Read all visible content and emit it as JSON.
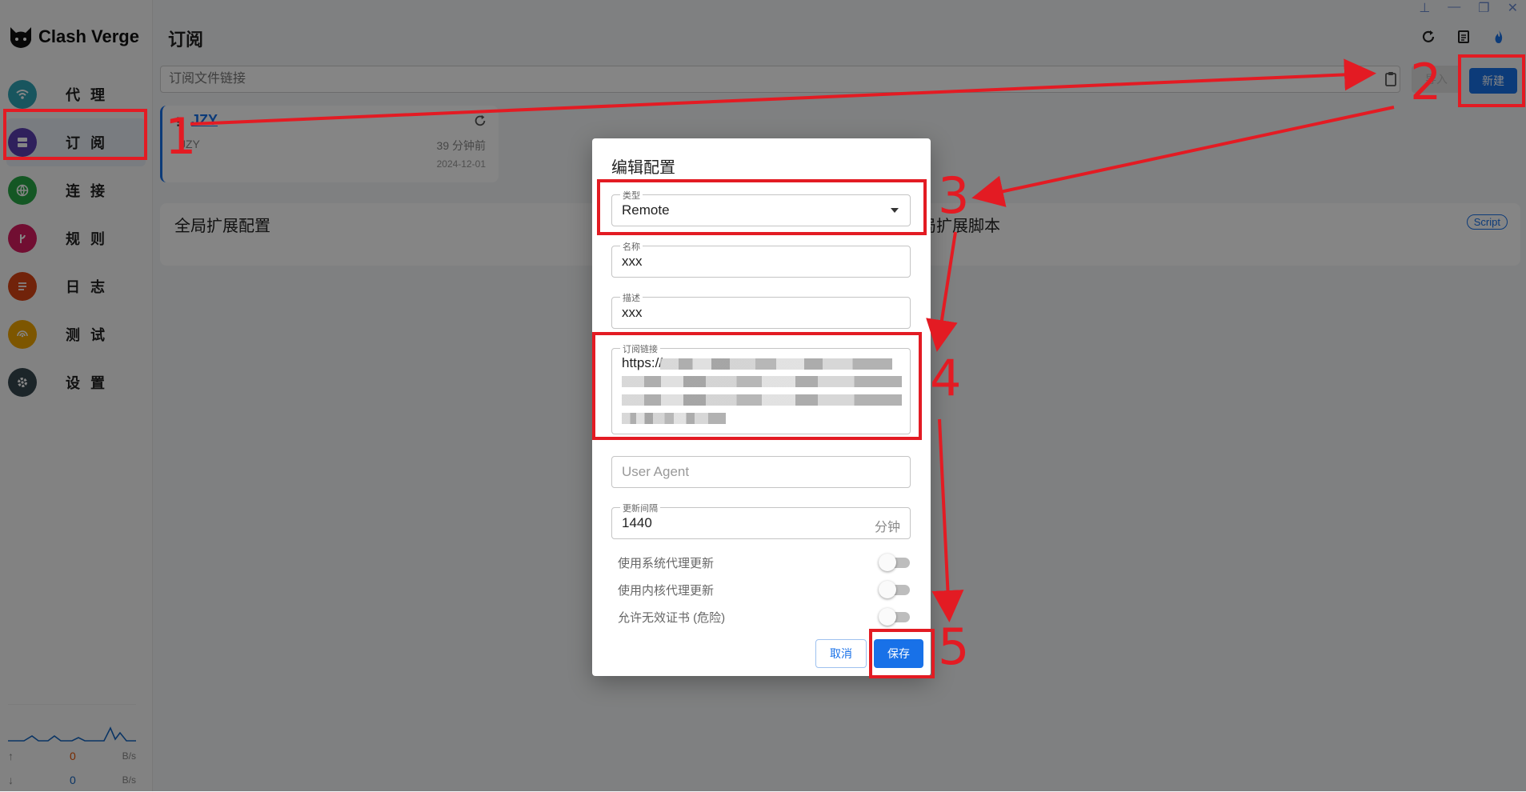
{
  "app": {
    "name": "Clash Verge"
  },
  "window_controls": [
    "pin-icon",
    "minimize-icon",
    "restore-icon",
    "close-icon"
  ],
  "sidebar": {
    "items": [
      {
        "label": "代 理",
        "icon": "wifi-icon",
        "color": "#2fa3b5"
      },
      {
        "label": "订 阅",
        "icon": "server-icon",
        "color": "#5b3fb0"
      },
      {
        "label": "连 接",
        "icon": "globe-icon",
        "color": "#28a745"
      },
      {
        "label": "规 则",
        "icon": "fork-icon",
        "color": "#d81b60"
      },
      {
        "label": "日 志",
        "icon": "log-icon",
        "color": "#d84315"
      },
      {
        "label": "测 试",
        "icon": "radar-icon",
        "color": "#f0a500"
      },
      {
        "label": "设 置",
        "icon": "gear-icon",
        "color": "#37474f"
      }
    ],
    "traffic": {
      "up": {
        "value": "0",
        "unit": "B/s",
        "color": "#e65100"
      },
      "down": {
        "value": "0",
        "unit": "B/s",
        "color": "#1565c0"
      }
    }
  },
  "header": {
    "title": "订阅"
  },
  "toolbar": {
    "url_placeholder": "订阅文件链接",
    "import_label": "导入",
    "new_label": "新建"
  },
  "profile": {
    "name": "JZY",
    "desc": "JZY",
    "updated": "39 分钟前",
    "date": "2024-12-01"
  },
  "global_card": {
    "title": "全局扩展配置",
    "script_title": "全局扩展脚本",
    "badge": "Script"
  },
  "dialog": {
    "title": "编辑配置",
    "type": {
      "label": "类型",
      "value": "Remote"
    },
    "name": {
      "label": "名称",
      "value": "xxx"
    },
    "desc": {
      "label": "描述",
      "value": "xxx"
    },
    "url": {
      "label": "订阅链接",
      "value": "https://"
    },
    "user_agent": {
      "placeholder": "User Agent"
    },
    "interval": {
      "label": "更新间隔",
      "value": "1440",
      "suffix": "分钟"
    },
    "toggles": [
      {
        "label": "使用系统代理更新",
        "on": false
      },
      {
        "label": "使用内核代理更新",
        "on": false
      },
      {
        "label": "允许无效证书 (危险)",
        "on": false
      }
    ],
    "cancel_label": "取消",
    "save_label": "保存"
  },
  "annotations": [
    "1",
    "2",
    "3",
    "4",
    "5"
  ],
  "accent_color": "#1871e8",
  "annotation_color": "#e31b23"
}
